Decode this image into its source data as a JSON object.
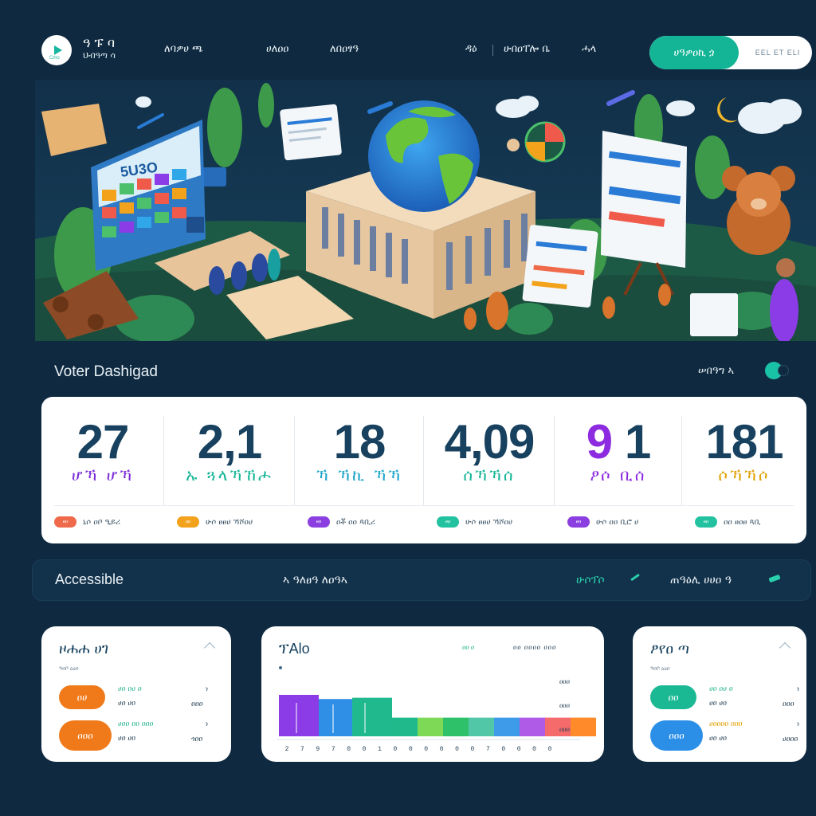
{
  "header": {
    "logo_sub": "Cmo",
    "brand_line1": "ዓ ፑ ባ",
    "brand_line2": "ህብዓጣ ሳ",
    "nav": [
      {
        "label": "ለባዎሀ  ጫ"
      },
      {
        "label": "ሀለዐዐ"
      },
      {
        "label": "ለበዐፃዓ"
      },
      {
        "label": "ዳዕ"
      },
      {
        "label": "ሁበዐፐሎ ቤ"
      },
      {
        "label": "ሓላ"
      }
    ],
    "cta_primary": "ሀዓዎዐኪ ጏ",
    "cta_secondary": "EEL ET    ELI"
  },
  "hero": {
    "screen_text": "5U3O"
  },
  "dashboard": {
    "title": "Voter Dashigad",
    "toggle_label": "ሠበዓግ ኣ"
  },
  "stats": [
    {
      "number": "27",
      "accent": "",
      "label": "ሆኻ ሆኻ",
      "label_color": "#7a2bd8",
      "pill_text": "ፀዐ",
      "pill_color": "#ef6a4a",
      "foot": "ኒሶ ዐቦ ዒይሪ"
    },
    {
      "number": "2,1",
      "accent": "",
      "label": "ኡ ጓላኻኸሖ",
      "label_color": "#13b596",
      "pill_text": "ዐዐ",
      "pill_color": "#f2a21b",
      "foot": "ሁሶ ፀፀሀ ኻሾዐሀ"
    },
    {
      "number": "18",
      "accent": "",
      "label": "ኻ ኻኪ ኻኻ",
      "label_color": "#1aa4c9",
      "pill_text": "ፀዐ",
      "pill_color": "#8c3fe0",
      "foot": "ዐቾ ዐዐ ጳቢሪ"
    },
    {
      "number": "4,09",
      "accent": "",
      "label": "ሰኻኻሰ",
      "label_color": "#13b596",
      "pill_text": "ፀዐ",
      "pill_color": "#22c2a1",
      "foot": "ሁሶ ፀፀሀ ኻሾዐሀ"
    },
    {
      "number": "1",
      "accent": "9",
      "label": "ፆሶ ቢሰ",
      "label_color": "#8c2be0",
      "pill_text": "ፀዐ",
      "pill_color": "#8c3fe0",
      "foot": "ሁሶ ዐዐ ቢሮ ሀ"
    },
    {
      "number": "181",
      "accent": "",
      "label": "ሶኻኻሶ",
      "label_color": "#e0a000",
      "pill_text": "ፀዐ",
      "pill_color": "#22c2a1",
      "foot": "ዐዐ ፀዐፀ ጳቢ"
    }
  ],
  "accessible": {
    "title": "Accessible",
    "middle": "ኣ ዓለፀዓ ለዐዓኣ",
    "link": "ሁሶፕሶ",
    "right": "ጠዓዕሊ ሀሀዐ ዓ"
  },
  "left_panel": {
    "title": "ዞሐሐ ሀገ",
    "sub": "ዓዐቦ ዕዕዐ",
    "rows": [
      {
        "pill": "ዐሀ",
        "pill_color": "#f07a1a",
        "a": "ሀዐ ዐሀ ዐ",
        "a_color": "#2ab58f",
        "b": "ሀዐ ሀዐ",
        "c": "ነ",
        "d": "ዐዐዐ"
      },
      {
        "pill": "ዐዐዐ",
        "pill_color": "#f07a1a",
        "a": "ሀዐዐ ዐዐ ዐዐዐ",
        "a_color": "#2ab58f",
        "b": "ሀዐ ሀዐ",
        "c": "ነ",
        "d": "ጎዐዐ"
      }
    ]
  },
  "right_panel": {
    "title": "ፆየዐ ጣ",
    "sub": "ዓዐቦ ዕዕዐ",
    "rows": [
      {
        "pill": "ዐዐ",
        "pill_color": "#1ab994",
        "a": "ሀዐ ዐሀ ዐ",
        "a_color": "#2ab58f",
        "b": "ሀዐ ሀዐ",
        "c": "ነ",
        "d": "ዐዐዐ"
      },
      {
        "pill": "ዐዐዐ",
        "pill_color": "#2b8fe8",
        "a": "ሀዐዐዐዐ ዐዐዐ",
        "a_color": "#e0a000",
        "b": "ሀዐ ሀዐ",
        "c": "ነ",
        "d": "ሀዐዐዐ"
      }
    ]
  },
  "chart_panel": {
    "title": "ፕAlo",
    "legend": "ዐዐ ዐ",
    "legend_right": "ዐዐ ዐዐዐዐ ዐዐዐ"
  },
  "chart_data": {
    "type": "bar",
    "values": [
      1.0,
      0.9,
      0.93,
      0.45,
      0.45,
      0.45,
      0.45,
      0.45,
      0.45,
      0.45,
      0.45
    ],
    "colors": [
      "#8b3ce6",
      "#2f8fe6",
      "#20b98e",
      "#1fb98c",
      "#7ed957",
      "#2fc06a",
      "#52c7a8",
      "#3d9be9",
      "#b05be8",
      "#f56a6a",
      "#ff8a2a"
    ],
    "tick_labels": [
      "2",
      "7",
      "9",
      "7",
      "0",
      "0",
      "1",
      "0",
      "0",
      "0",
      "0",
      "0",
      "0",
      "7",
      "0",
      "0",
      "0",
      "0"
    ],
    "y_tick_labels": [
      "ዐዐዐ",
      "ዐዐዐ",
      "ዐዐዐ"
    ]
  },
  "icons": [
    "play-icon",
    "chevron-right-icon",
    "pencil-icon"
  ]
}
